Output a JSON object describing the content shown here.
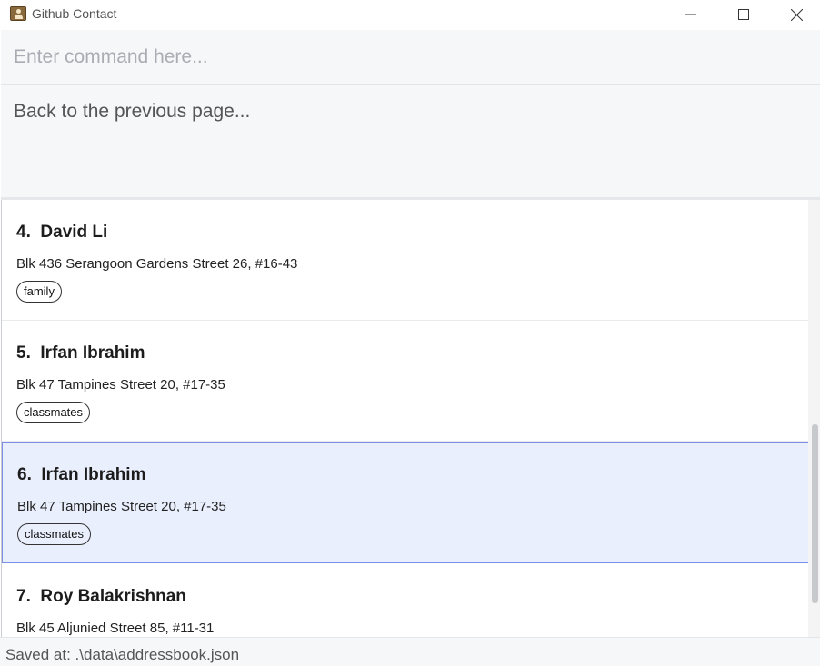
{
  "window": {
    "title": "Github Contact",
    "icon": "contact-book-icon",
    "controls": [
      "minimize-icon",
      "maximize-icon",
      "close-icon"
    ]
  },
  "command": {
    "value": "",
    "placeholder": "Enter command here..."
  },
  "result": {
    "text": "Back to the previous page..."
  },
  "persons": [
    {
      "name": "4.  David Li",
      "address": "Blk 436 Serangoon Gardens Street 26, #16-43",
      "tag": "family",
      "selected": false
    },
    {
      "name": "5.  Irfan Ibrahim",
      "address": "Blk 47 Tampines Street 20, #17-35",
      "tag": "classmates",
      "selected": false
    },
    {
      "name": "6.  Irfan Ibrahim",
      "address": "Blk 47 Tampines Street 20, #17-35",
      "tag": "classmates",
      "selected": true
    },
    {
      "name": "7.  Roy Balakrishnan",
      "address": "Blk 45 Aljunied Street 85, #11-31",
      "tag": "",
      "selected": false
    }
  ],
  "status": {
    "text": "Saved at: .\\data\\addressbook.json"
  },
  "colors": {
    "selected_bg": "#eaeffd",
    "selected_border": "#7d8ee8",
    "panel_bg": "#f6f7f9"
  }
}
